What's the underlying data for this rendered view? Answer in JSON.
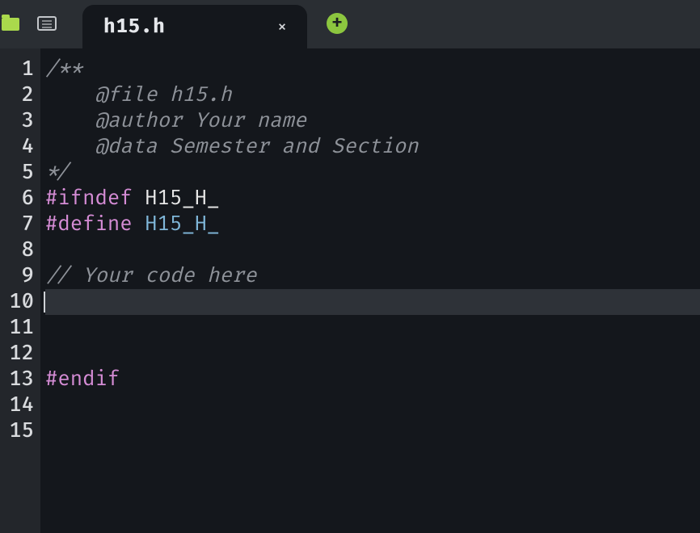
{
  "tab": {
    "filename": "h15.h",
    "close_glyph": "×",
    "add_glyph": "+"
  },
  "gutter": {
    "line_count": 15,
    "current_line": 10
  },
  "code": {
    "lines": [
      {
        "n": 1,
        "tokens": [
          {
            "cls": "tok-comment",
            "text": "/**"
          }
        ]
      },
      {
        "n": 2,
        "tokens": [
          {
            "cls": "tok-comment",
            "text": "    @file h15.h"
          }
        ]
      },
      {
        "n": 3,
        "tokens": [
          {
            "cls": "tok-comment",
            "text": "    @author Your name"
          }
        ]
      },
      {
        "n": 4,
        "tokens": [
          {
            "cls": "tok-comment",
            "text": "    @data Semester and Section"
          }
        ]
      },
      {
        "n": 5,
        "tokens": [
          {
            "cls": "tok-comment",
            "text": "*/"
          }
        ]
      },
      {
        "n": 6,
        "tokens": [
          {
            "cls": "tok-prep",
            "text": "#ifndef"
          },
          {
            "cls": "tok-ident",
            "text": " H15_H_"
          }
        ]
      },
      {
        "n": 7,
        "tokens": [
          {
            "cls": "tok-prep",
            "text": "#define"
          },
          {
            "cls": "tok-ident",
            "text": " "
          },
          {
            "cls": "tok-macro",
            "text": "H15_H_"
          }
        ]
      },
      {
        "n": 8,
        "tokens": []
      },
      {
        "n": 9,
        "tokens": [
          {
            "cls": "tok-comment",
            "text": "// Your code here"
          }
        ]
      },
      {
        "n": 10,
        "tokens": [],
        "current": true
      },
      {
        "n": 11,
        "tokens": []
      },
      {
        "n": 12,
        "tokens": []
      },
      {
        "n": 13,
        "tokens": [
          {
            "cls": "tok-prep",
            "text": "#endif"
          }
        ]
      },
      {
        "n": 14,
        "tokens": []
      },
      {
        "n": 15,
        "tokens": []
      }
    ]
  }
}
